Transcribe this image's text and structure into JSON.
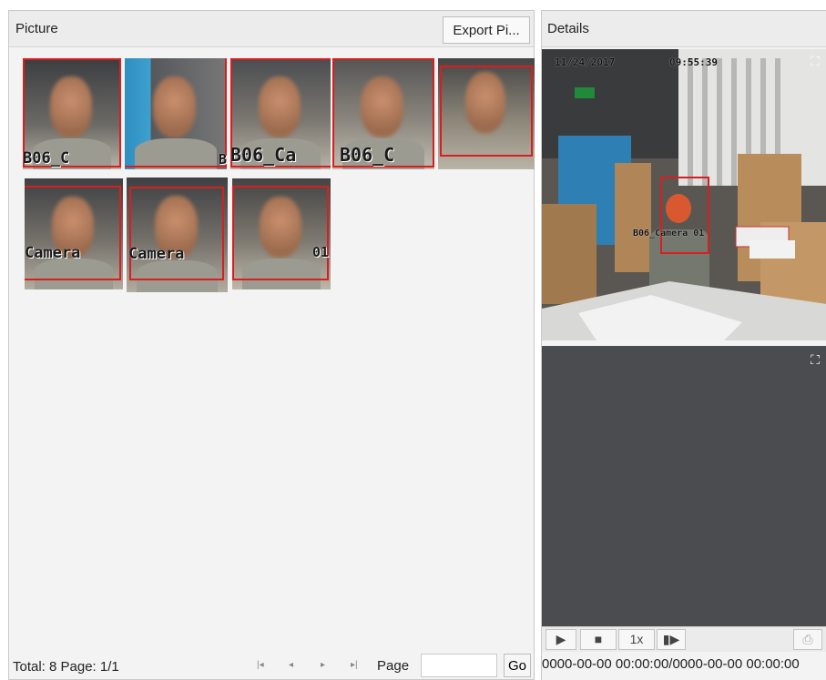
{
  "picture_panel": {
    "title": "Picture",
    "export_button": "Export Pi...",
    "thumbnails": [
      {
        "overlay": "B06_C"
      },
      {
        "overlay": "B"
      },
      {
        "overlay": "B06_Ca"
      },
      {
        "overlay": "B06_C"
      },
      {
        "overlay": ""
      },
      {
        "overlay": "Camera"
      },
      {
        "overlay": "Camera",
        "selected": true
      },
      {
        "overlay": "01"
      }
    ],
    "footer": {
      "total_label": "Total: 8  Page: 1/1",
      "page_label": "Page",
      "page_value": "",
      "go_label": "Go"
    }
  },
  "details_panel": {
    "title": "Details",
    "scene_date": "11/24/2017",
    "scene_time": "09:55:39",
    "scene_camera_label": "B06_Camera 01",
    "controls": {
      "speed": "1x"
    },
    "time_range": "0000-00-00 00:00:00/0000-00-00 00:00:00"
  },
  "colors": {
    "detection_box": "#d81e1e",
    "selected_border": "#f0e020",
    "video_background": "#4a4c4f"
  }
}
